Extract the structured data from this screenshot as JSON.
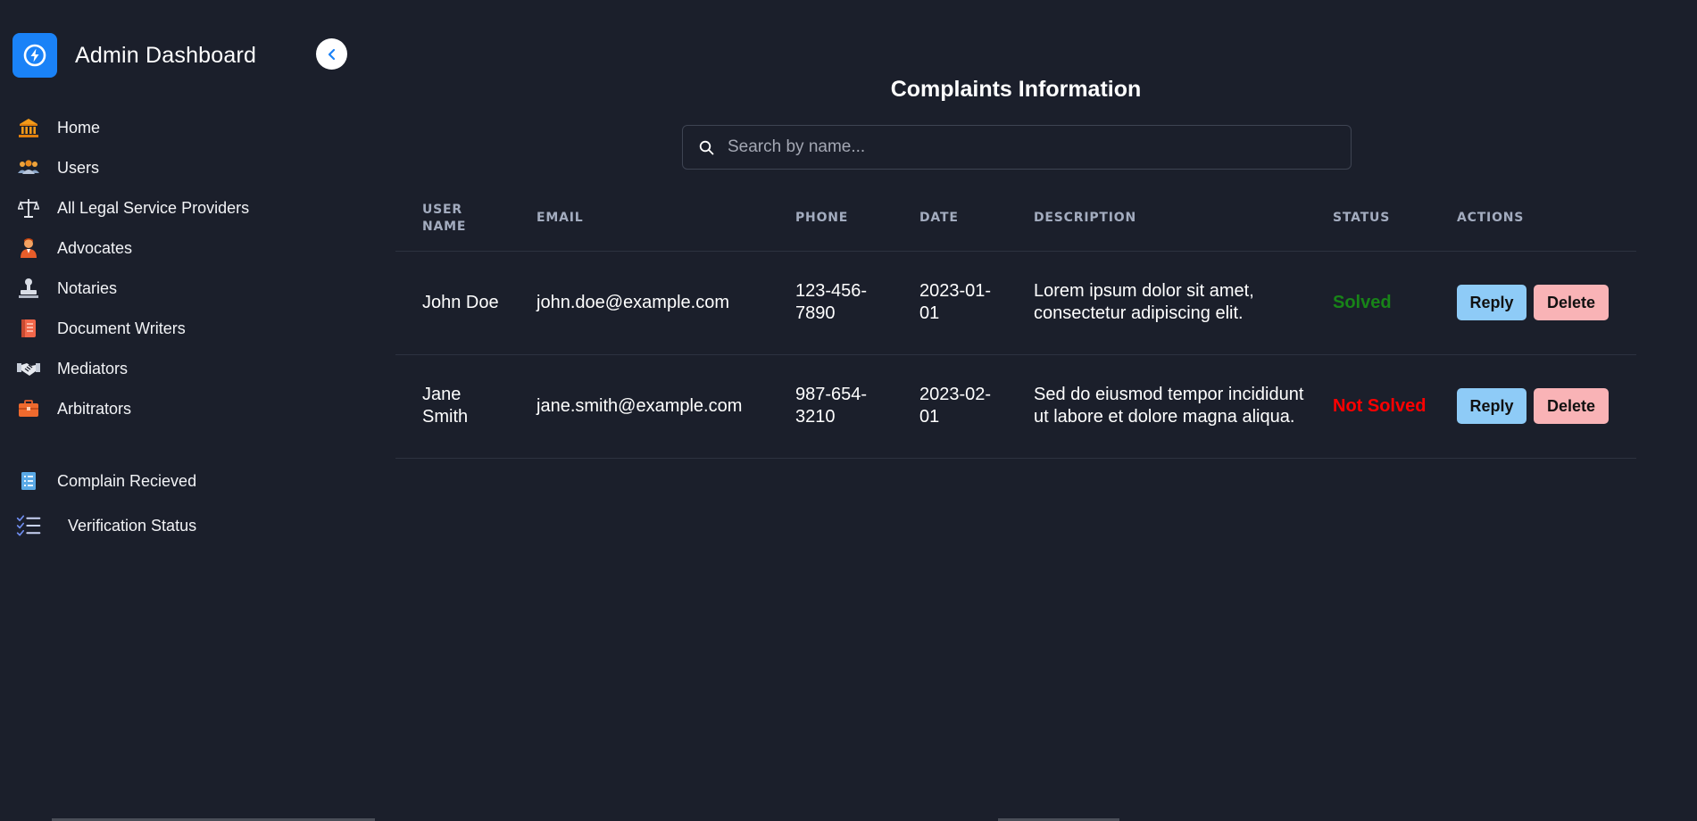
{
  "sidebar": {
    "title": "Admin Dashboard",
    "items": [
      {
        "label": "Home",
        "icon": "bank-icon"
      },
      {
        "label": "Users",
        "icon": "users-icon"
      },
      {
        "label": "All Legal Service Providers",
        "icon": "scales-icon"
      },
      {
        "label": "Advocates",
        "icon": "advocate-icon"
      },
      {
        "label": "Notaries",
        "icon": "stamp-icon"
      },
      {
        "label": "Document Writers",
        "icon": "document-icon"
      },
      {
        "label": "Mediators",
        "icon": "handshake-icon"
      },
      {
        "label": "Arbitrators",
        "icon": "briefcase-icon"
      },
      {
        "label": "Complain Recieved",
        "icon": "list-icon"
      },
      {
        "label": "Verification Status",
        "icon": "checklist-icon"
      }
    ]
  },
  "main": {
    "title": "Complaints Information",
    "search": {
      "placeholder": "Search by name...",
      "value": ""
    },
    "table": {
      "headers": [
        "USER NAME",
        "EMAIL",
        "PHONE",
        "DATE",
        "DESCRIPTION",
        "STATUS",
        "ACTIONS"
      ],
      "rows": [
        {
          "name": "John Doe",
          "email": "john.doe@example.com",
          "phone": "123-456-7890",
          "date": "2023-01-01",
          "description": "Lorem ipsum dolor sit amet, consectetur adipiscing elit.",
          "status": "Solved",
          "reply": "Reply",
          "delete": "Delete"
        },
        {
          "name": "Jane Smith",
          "email": "jane.smith@example.com",
          "phone": "987-654-3210",
          "date": "2023-02-01",
          "description": "Sed do eiusmod tempor incididunt ut labore et dolore magna aliqua.",
          "status": "Not Solved",
          "reply": "Reply",
          "delete": "Delete"
        }
      ]
    }
  },
  "colors": {
    "background": "#1b1f2b",
    "brand": "#1a82f7",
    "solved": "#188418",
    "not_solved": "#ff0000",
    "reply_button": "#8ecbf7",
    "delete_button": "#f9b3b6"
  }
}
